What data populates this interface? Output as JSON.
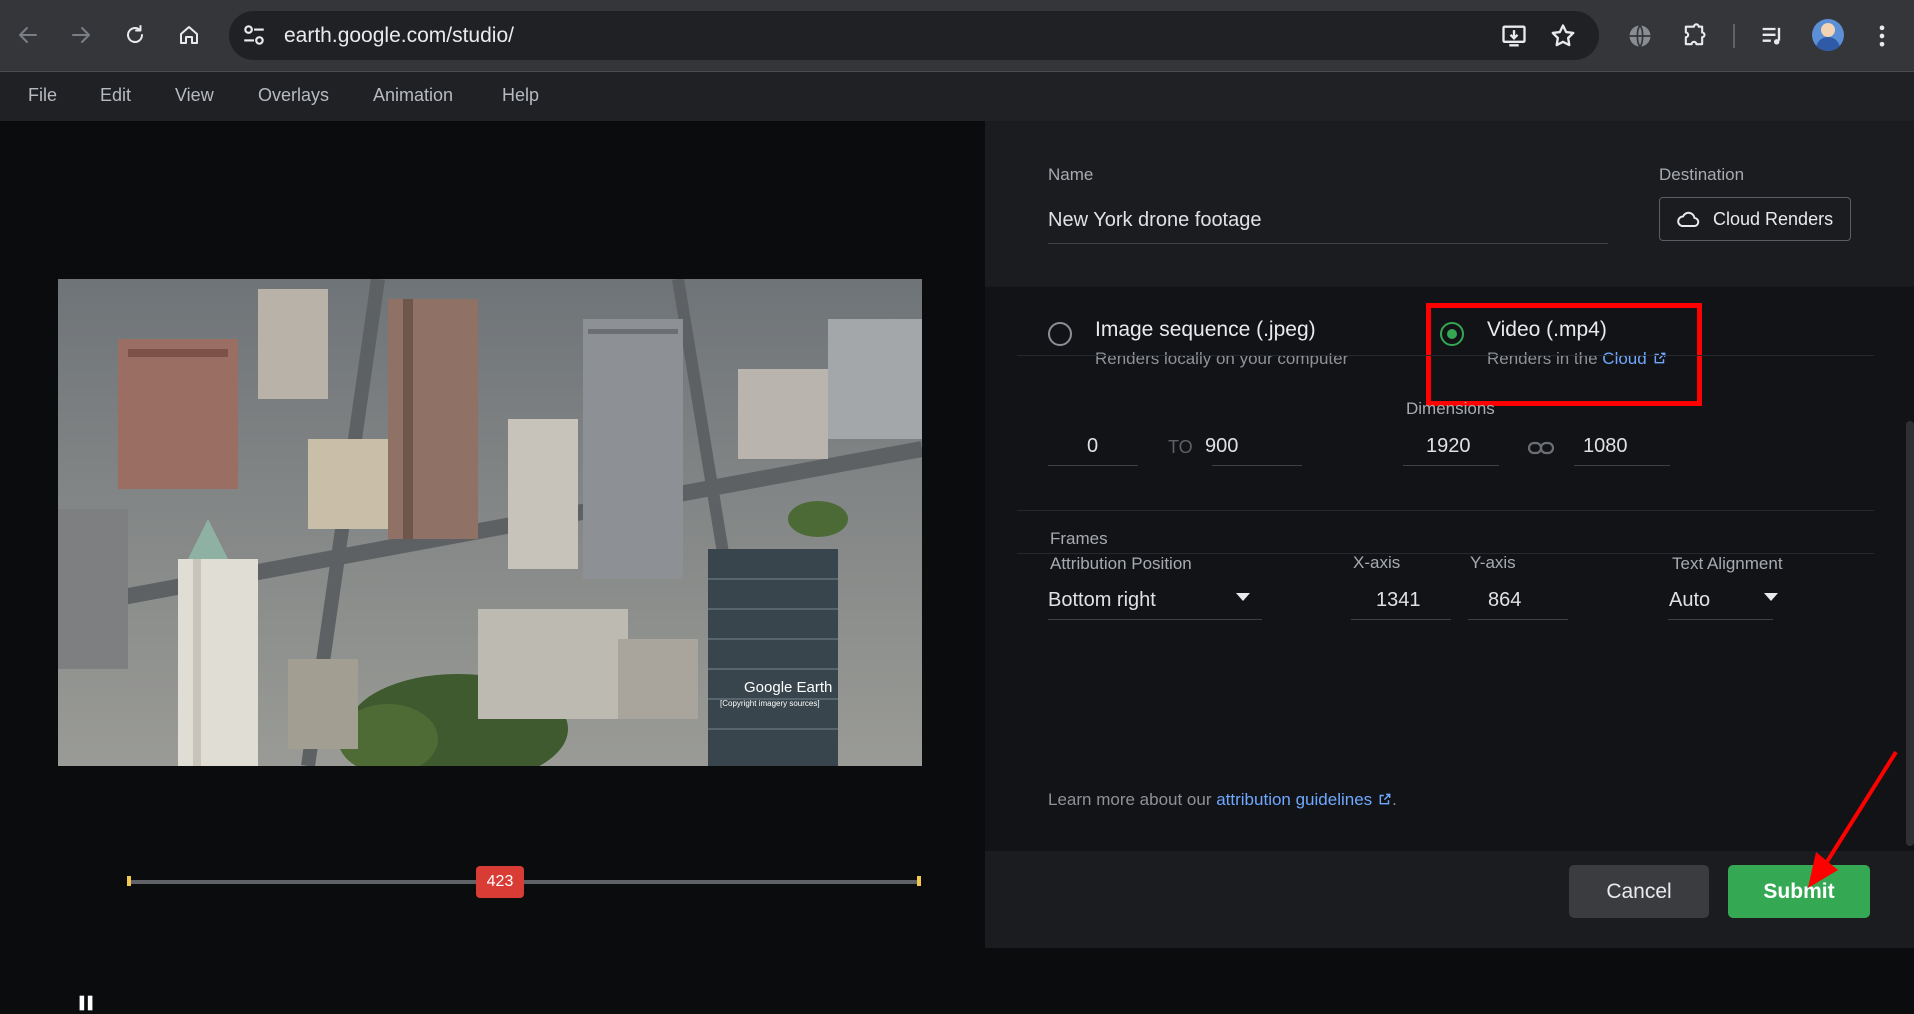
{
  "browser": {
    "url": "earth.google.com/studio/"
  },
  "menu": {
    "items": [
      "File",
      "Edit",
      "View",
      "Overlays",
      "Animation",
      "Help"
    ]
  },
  "preview": {
    "watermark_brand": "Google Earth",
    "watermark_credit": "[Copyright imagery sources]",
    "playhead_frame": "423",
    "timeline_progress": 0.47
  },
  "form": {
    "name_label": "Name",
    "name_value": "New York drone footage",
    "destination_label": "Destination",
    "destination_button": "Cloud Renders",
    "format_options": [
      {
        "title": "Image sequence (.jpeg)",
        "subtitle": "Renders locally on your computer",
        "selected": false
      },
      {
        "title": "Video (.mp4)",
        "subtitle": "Renders in the ",
        "link": "Cloud",
        "selected": true
      }
    ],
    "frames_label": "Frames",
    "frames_from": "0",
    "frames_to_sep": "TO",
    "frames_to": "900",
    "dimensions_label": "Dimensions",
    "width": "1920",
    "height": "1080",
    "attribution_label": "Attribution Position",
    "attribution_value": "Bottom right",
    "xaxis_label": "X-axis",
    "xaxis_value": "1341",
    "yaxis_label": "Y-axis",
    "yaxis_value": "864",
    "text_align_label": "Text Alignment",
    "text_align_value": "Auto",
    "learn_more_prefix": "Learn more about our ",
    "learn_more_link": "attribution guidelines",
    "learn_more_suffix": "."
  },
  "actions": {
    "cancel": "Cancel",
    "submit": "Submit"
  },
  "colors": {
    "submit_green": "#34a853",
    "highlight_red": "#ff0000",
    "link_blue": "#6ea8ff",
    "playhead_red": "#d93c35"
  }
}
